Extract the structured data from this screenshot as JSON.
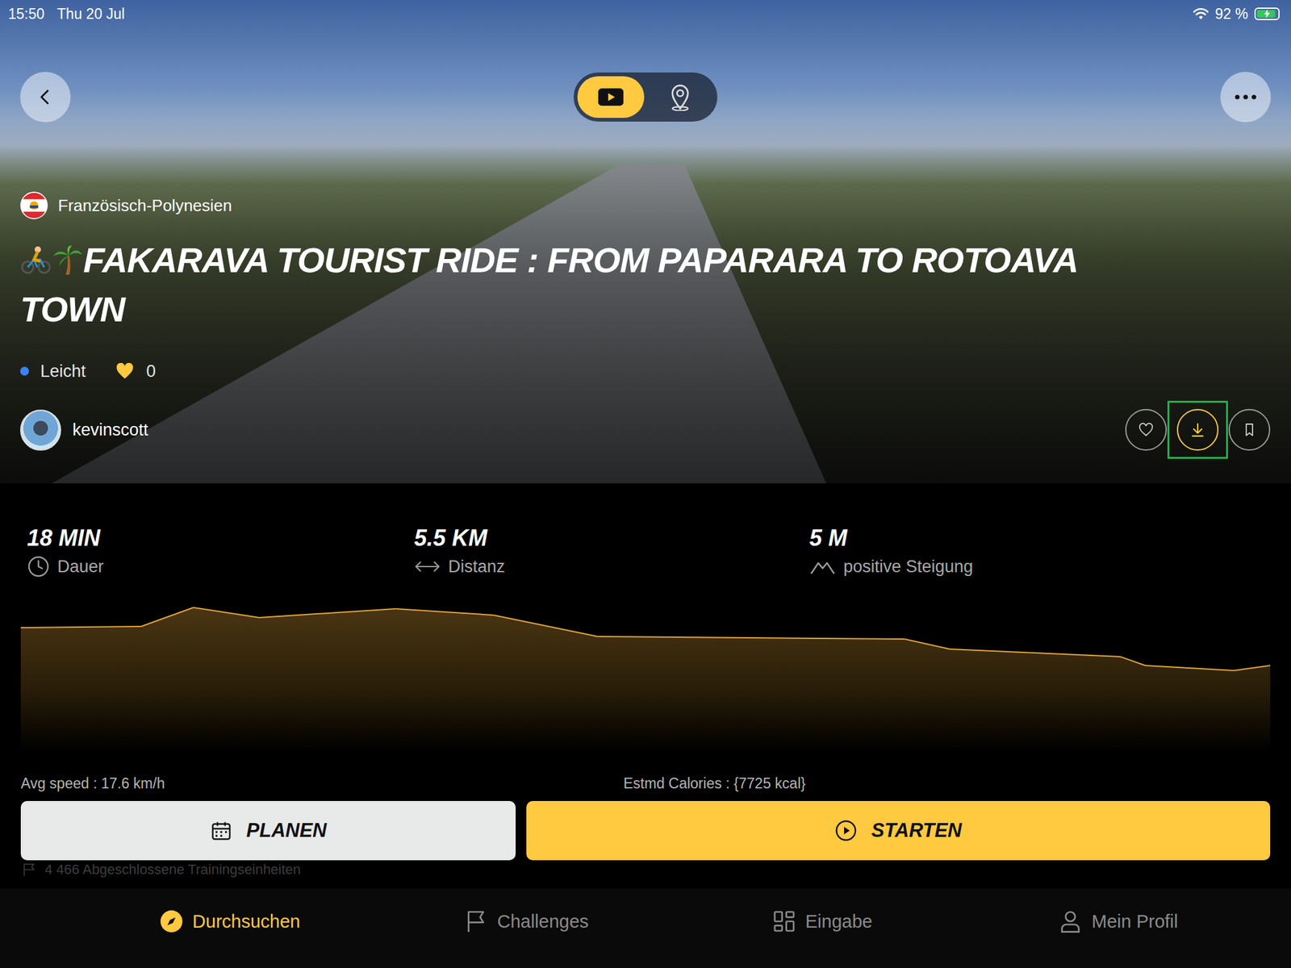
{
  "status_bar": {
    "time": "15:50",
    "date": "Thu 20 Jul",
    "battery": "92 %",
    "battery_level": 0.92,
    "charging": true
  },
  "view_toggle": [
    {
      "kind": "video",
      "selected": true
    },
    {
      "kind": "map",
      "selected": false
    }
  ],
  "ride": {
    "country": "Französisch-Polynesien",
    "title": "FAKARAVA TOURIST RIDE : FROM PAPARARA TO ROTOAVA TOWN",
    "difficulty": "Leicht",
    "difficulty_color": "#3b82f6",
    "likes": "0",
    "author": "kevinscott"
  },
  "actions": [
    {
      "kind": "like",
      "active": false,
      "highlighted": false
    },
    {
      "kind": "download",
      "active": true,
      "highlighted": true
    },
    {
      "kind": "bookmark",
      "active": false,
      "highlighted": false
    }
  ],
  "stats": [
    {
      "kind": "duration",
      "value": "18 MIN",
      "label": "Dauer"
    },
    {
      "kind": "distance",
      "value": "5.5 KM",
      "label": "Distanz"
    },
    {
      "kind": "climb",
      "value": "5 M",
      "label": "positive Steigung"
    }
  ],
  "profile": {
    "distance_km": [
      0,
      0.53,
      0.76,
      1.05,
      1.65,
      2.08,
      2.54,
      3.89,
      4.09,
      4.84,
      4.95,
      5.34,
      5.5
    ],
    "elevation_m": [
      3.6,
      3.7,
      5.2,
      4.4,
      5.1,
      4.6,
      2.9,
      2.7,
      1.9,
      1.3,
      0.6,
      0.2,
      0.6
    ]
  },
  "avg_speed": "Avg speed : 17.6 km/h",
  "calories": "Estmd Calories : {7725 kcal}",
  "buttons": [
    {
      "kind": "plan",
      "label": "PLANEN"
    },
    {
      "kind": "start",
      "label": "STARTEN"
    }
  ],
  "completed": "4 466 Abgeschlossene Trainingseinheiten",
  "tab_bar": [
    {
      "kind": "browse",
      "label": "Durchsuchen",
      "selected": true
    },
    {
      "kind": "challenges",
      "label": "Challenges",
      "selected": false
    },
    {
      "kind": "input",
      "label": "Eingabe",
      "selected": false
    },
    {
      "kind": "profile",
      "label": "Mein Profil",
      "selected": false
    }
  ]
}
